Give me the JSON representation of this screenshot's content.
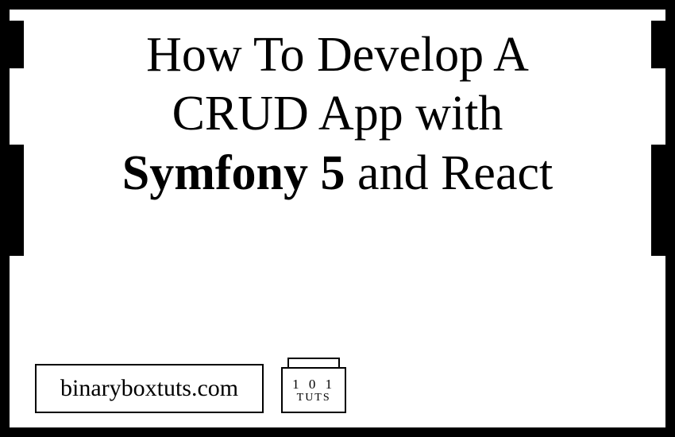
{
  "title": {
    "line1": "How To Develop A",
    "line2": "CRUD App with",
    "line3_bold": "Symfony 5",
    "line3_rest": " and React"
  },
  "footer": {
    "site": "binaryboxtuts.com",
    "logo_top": "1 0 1",
    "logo_bottom": "TUTS"
  }
}
